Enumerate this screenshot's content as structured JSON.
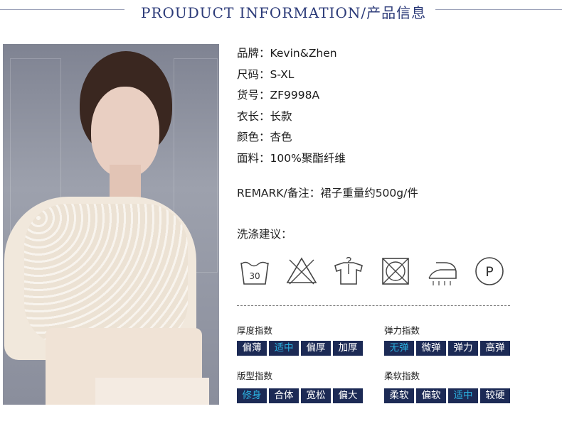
{
  "header": {
    "title": "PROUDUCT INFORMATION/产品信息"
  },
  "photo": {
    "alt": "model-photo"
  },
  "info": {
    "rows": [
      "品牌：Kevin&Zhen",
      "尺码：S-XL",
      "货号：ZF9998A",
      "衣长：长款",
      "颜色：杏色",
      "面料：100%聚酯纤维"
    ],
    "remark": "REMARK/备注：裙子重量约500g/件",
    "care_label": "洗涤建议："
  },
  "care_icons": {
    "wash_temp": "30",
    "dryclean_letter": "P",
    "icons": [
      "wash-30-icon",
      "no-bleach-icon",
      "hang-dry-icon",
      "no-tumble-dry-icon",
      "iron-low-icon",
      "dryclean-p-icon"
    ]
  },
  "indices": {
    "thickness": {
      "title": "厚度指数",
      "options": [
        "偏薄",
        "适中",
        "偏厚",
        "加厚"
      ],
      "selected": 1
    },
    "elasticity": {
      "title": "弹力指数",
      "options": [
        "无弹",
        "微弹",
        "弹力",
        "高弹"
      ],
      "selected": 0
    },
    "fit": {
      "title": "版型指数",
      "options": [
        "修身",
        "合体",
        "宽松",
        "偏大"
      ],
      "selected": 0
    },
    "softness": {
      "title": "柔软指数",
      "options": [
        "柔软",
        "偏软",
        "适中",
        "较硬"
      ],
      "selected": 2
    }
  },
  "colors": {
    "scale_bg": "#1c2a55",
    "selected_text": "#2bb0e0",
    "title": "#2b3a78"
  }
}
